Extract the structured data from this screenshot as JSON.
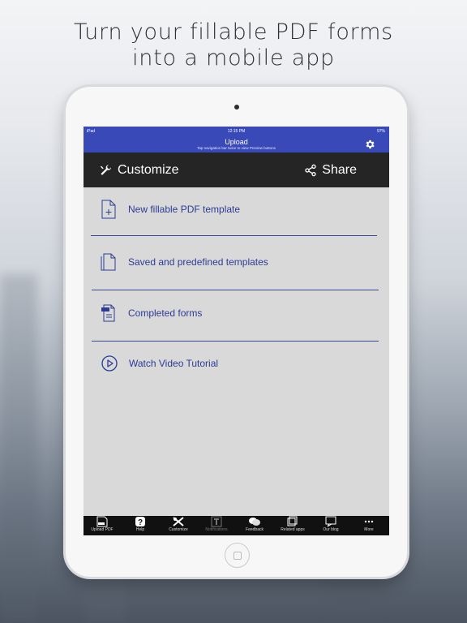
{
  "headline": [
    "Turn your fillable PDF forms",
    "into a mobile app"
  ],
  "status_bar": {
    "device": "iPad",
    "time": "12:15 PM",
    "battery": "97%"
  },
  "nav_bar": {
    "title": "Upload",
    "subtitle": "Tap navigation bar twice to view Preview buttons",
    "icon": "gear-icon"
  },
  "toolbar": {
    "customize_label": "Customize",
    "share_label": "Share"
  },
  "menu": [
    {
      "label": "New fillable PDF template",
      "icon": "new-template-icon"
    },
    {
      "label": "Saved and predefined templates",
      "icon": "documents-icon"
    },
    {
      "label": "Completed forms",
      "icon": "pdf-file-icon"
    },
    {
      "label": "Watch Video Tutorial",
      "icon": "play-icon"
    }
  ],
  "tabs": [
    {
      "label": "Upload PDF",
      "icon": "upload-pdf-icon"
    },
    {
      "label": "Help",
      "icon": "help-icon"
    },
    {
      "label": "Customize",
      "icon": "tools-icon"
    },
    {
      "label": "Notifications",
      "icon": "notifications-icon"
    },
    {
      "label": "Feedback",
      "icon": "feedback-icon"
    },
    {
      "label": "Related apps",
      "icon": "related-apps-icon"
    },
    {
      "label": "Our blog",
      "icon": "blog-icon"
    },
    {
      "label": "More",
      "icon": "more-icon"
    }
  ],
  "colors": {
    "nav_blue": "#3a49b8",
    "toolbar_dark": "#252525",
    "menu_text_blue": "#2c3b94",
    "screen_gray": "#d9d9d9"
  }
}
